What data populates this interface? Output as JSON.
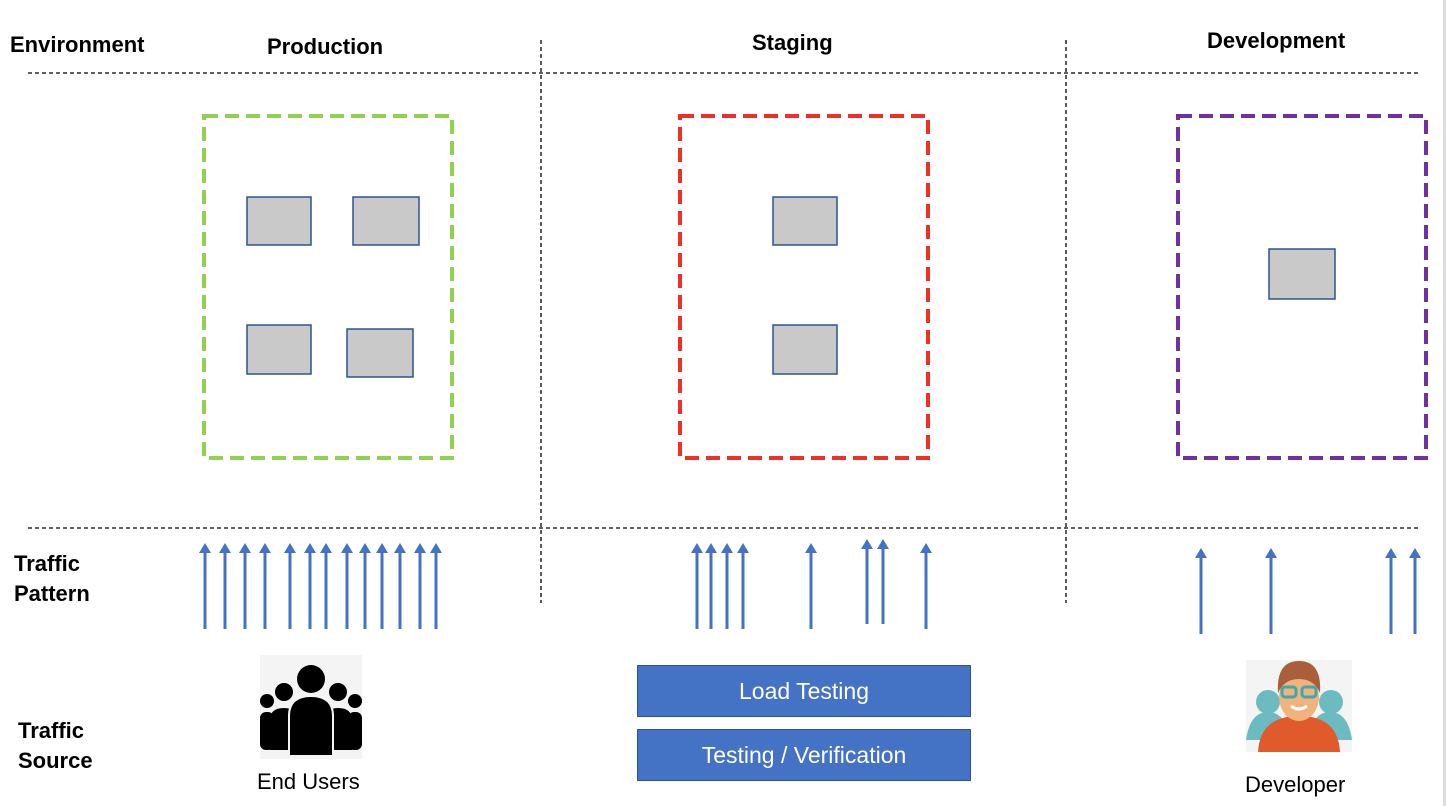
{
  "row_labels": {
    "environment": "Environment",
    "traffic_pattern": "Traffic\nPattern",
    "traffic_source": "Traffic\nSource"
  },
  "columns": [
    {
      "title": "Production",
      "box_color": "#92d050",
      "servers": 4,
      "source": "End Users",
      "source_icon": "users-group-icon"
    },
    {
      "title": "Staging",
      "box_color": "#ee3124",
      "servers": 2,
      "sources": [
        "Load Testing",
        "Testing / Verification"
      ]
    },
    {
      "title": "Development",
      "box_color": "#7030a0",
      "servers": 1,
      "source": "Developer",
      "source_icon": "developer-avatar-icon"
    }
  ],
  "colors": {
    "arrow": "#4472c4",
    "server_fill": "#c9c9c9",
    "server_border": "#2f528f",
    "button": "#4472c4"
  }
}
